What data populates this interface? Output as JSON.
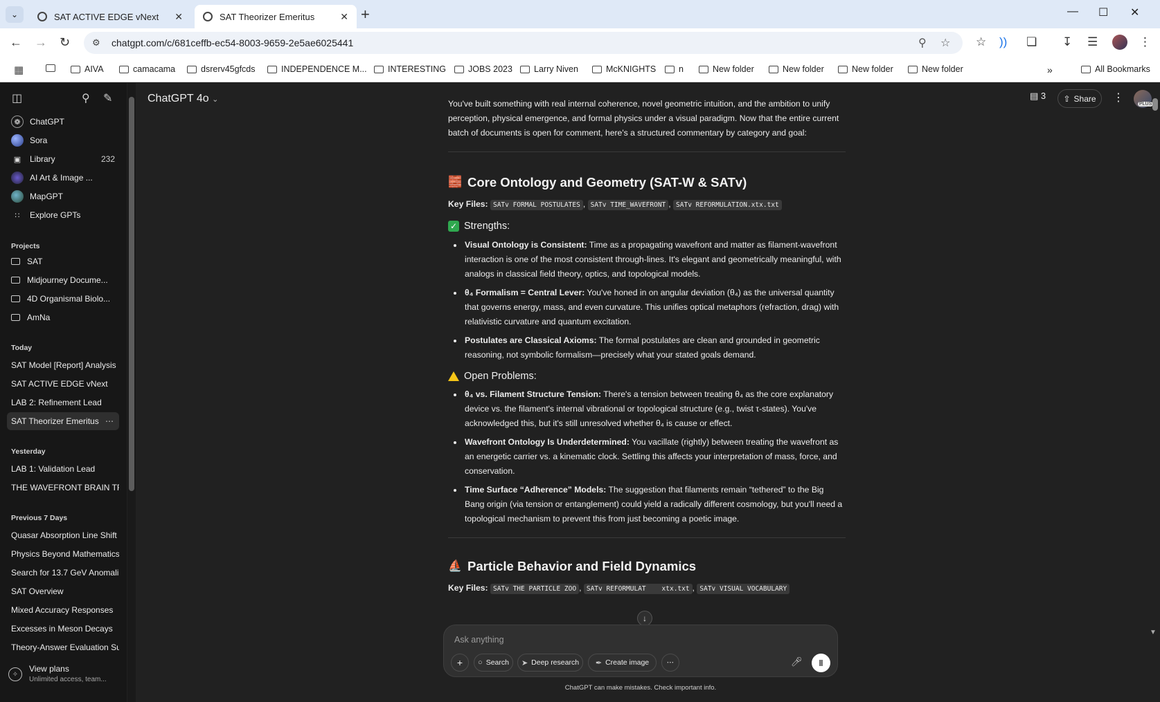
{
  "browser": {
    "tabs": [
      {
        "title": "SAT ACTIVE EDGE vNext",
        "active": false
      },
      {
        "title": "SAT Theorizer Emeritus",
        "active": true
      }
    ],
    "url": "chatgpt.com/c/681ceffb-ec54-8003-9659-2e5ae6025441",
    "bookmarks": [
      "AIVA",
      "camacama",
      "dsrerv45gfcds",
      "INDEPENDENCE M...",
      "INTERESTING",
      "JOBS 2023",
      "Larry Niven",
      "McKNIGHTS",
      "n",
      "New folder",
      "New folder",
      "New folder",
      "New folder"
    ],
    "all_bookmarks": "All Bookmarks"
  },
  "sidebar": {
    "top_items": [
      {
        "label": "ChatGPT",
        "icon": "chatgpt-logo-icon"
      },
      {
        "label": "Sora",
        "icon": "sora-icon"
      },
      {
        "label": "Library",
        "icon": "library-icon",
        "count": "232"
      },
      {
        "label": "AI Art & Image ...",
        "icon": "gpt-avatar-icon"
      },
      {
        "label": "MapGPT",
        "icon": "globe-icon"
      },
      {
        "label": "Explore GPTs",
        "icon": "grid-icon"
      }
    ],
    "projects_heading": "Projects",
    "projects": [
      "SAT",
      "Midjourney Docume...",
      "4D Organismal Biolo...",
      "AmNa"
    ],
    "today_heading": "Today",
    "today": [
      "SAT Model [Report] Analysis",
      "SAT ACTIVE EDGE vNext",
      "LAB 2: Refinement Lead",
      "SAT Theorizer Emeritus"
    ],
    "active_chat": "SAT Theorizer Emeritus",
    "yesterday_heading": "Yesterday",
    "yesterday": [
      "LAB 1: Validation Lead",
      "THE WAVEFRONT BRAIN TRU"
    ],
    "prev7_heading": "Previous 7 Days",
    "prev7": [
      "Quasar Absorption Line Shift",
      "Physics Beyond Mathematics",
      "Search for 13.7 GeV Anomali",
      "SAT Overview",
      "Mixed Accuracy Responses",
      "Excesses in Meson Decays",
      "Theory-Answer Evaluation Su"
    ],
    "view_plans": {
      "title": "View plans",
      "subtitle": "Unlimited access, team..."
    }
  },
  "header": {
    "model": "ChatGPT 4o",
    "doc_count": "3",
    "share": "Share",
    "plus_badge": "PLUS"
  },
  "content": {
    "intro": "You've built something with real internal coherence, novel geometric intuition, and the ambition to unify perception, physical emergence, and formal physics under a visual paradigm. Now that the entire current batch of documents is open for comment, here's a structured commentary by category and goal:",
    "section1": {
      "title": "Core Ontology and Geometry (SAT-W & SATv)",
      "keyfiles_label": "Key Files:",
      "files": [
        "SATv FORMAL POSTULATES",
        "SATv TIME_WAVEFRONT",
        "SATv REFORMULATION.xtx.txt"
      ],
      "strengths_heading": "Strengths:",
      "strengths": [
        {
          "b": "Visual Ontology is Consistent:",
          "t": " Time as a propagating wavefront and matter as filament-wavefront interaction is one of the most consistent through-lines. It's elegant and geometrically meaningful, with analogs in classical field theory, optics, and topological models."
        },
        {
          "b": "θ₄ Formalism = Central Lever:",
          "t": " You've honed in on angular deviation (θ₄) as the universal quantity that governs energy, mass, and even curvature. This unifies optical metaphors (refraction, drag) with relativistic curvature and quantum excitation."
        },
        {
          "b": "Postulates are Classical Axioms:",
          "t": " The formal postulates are clean and grounded in geometric reasoning, not symbolic formalism—precisely what your stated goals demand."
        }
      ],
      "problems_heading": "Open Problems:",
      "problems": [
        {
          "b": "θ₄ vs. Filament Structure Tension:",
          "t": " There's a tension between treating θ₄ as the core explanatory device vs. the filament's internal vibrational or topological structure (e.g., twist τ-states). You've acknowledged this, but it's still unresolved whether θ₄ is cause or effect."
        },
        {
          "b": "Wavefront Ontology Is Underdetermined:",
          "t": " You vacillate (rightly) between treating the wavefront as an energetic carrier vs. a kinematic clock. Settling this affects your interpretation of mass, force, and conservation."
        },
        {
          "b": "Time Surface “Adherence” Models:",
          "t": " The suggestion that filaments remain “tethered” to the Big Bang origin (via tension or entanglement) could yield a radically different cosmology, but you'll need a topological mechanism to prevent this from just becoming a poetic image."
        }
      ]
    },
    "section2": {
      "title": "Particle Behavior and Field Dynamics",
      "keyfiles_label": "Key Files:",
      "files": [
        "SATv THE PARTICLE ZOO",
        "SATv REFORMULAT",
        "xtx.txt",
        "SATv VISUAL VOCABULARY"
      ]
    }
  },
  "composer": {
    "placeholder": "Ask anything",
    "buttons": [
      "Search",
      "Deep research",
      "Create image"
    ],
    "disclaimer": "ChatGPT can make mistakes. Check important info."
  },
  "colors": {
    "accent_check": "#2fa84f",
    "warning": "#f5c518",
    "bg": "#212121",
    "sidebar_bg": "#171717"
  }
}
